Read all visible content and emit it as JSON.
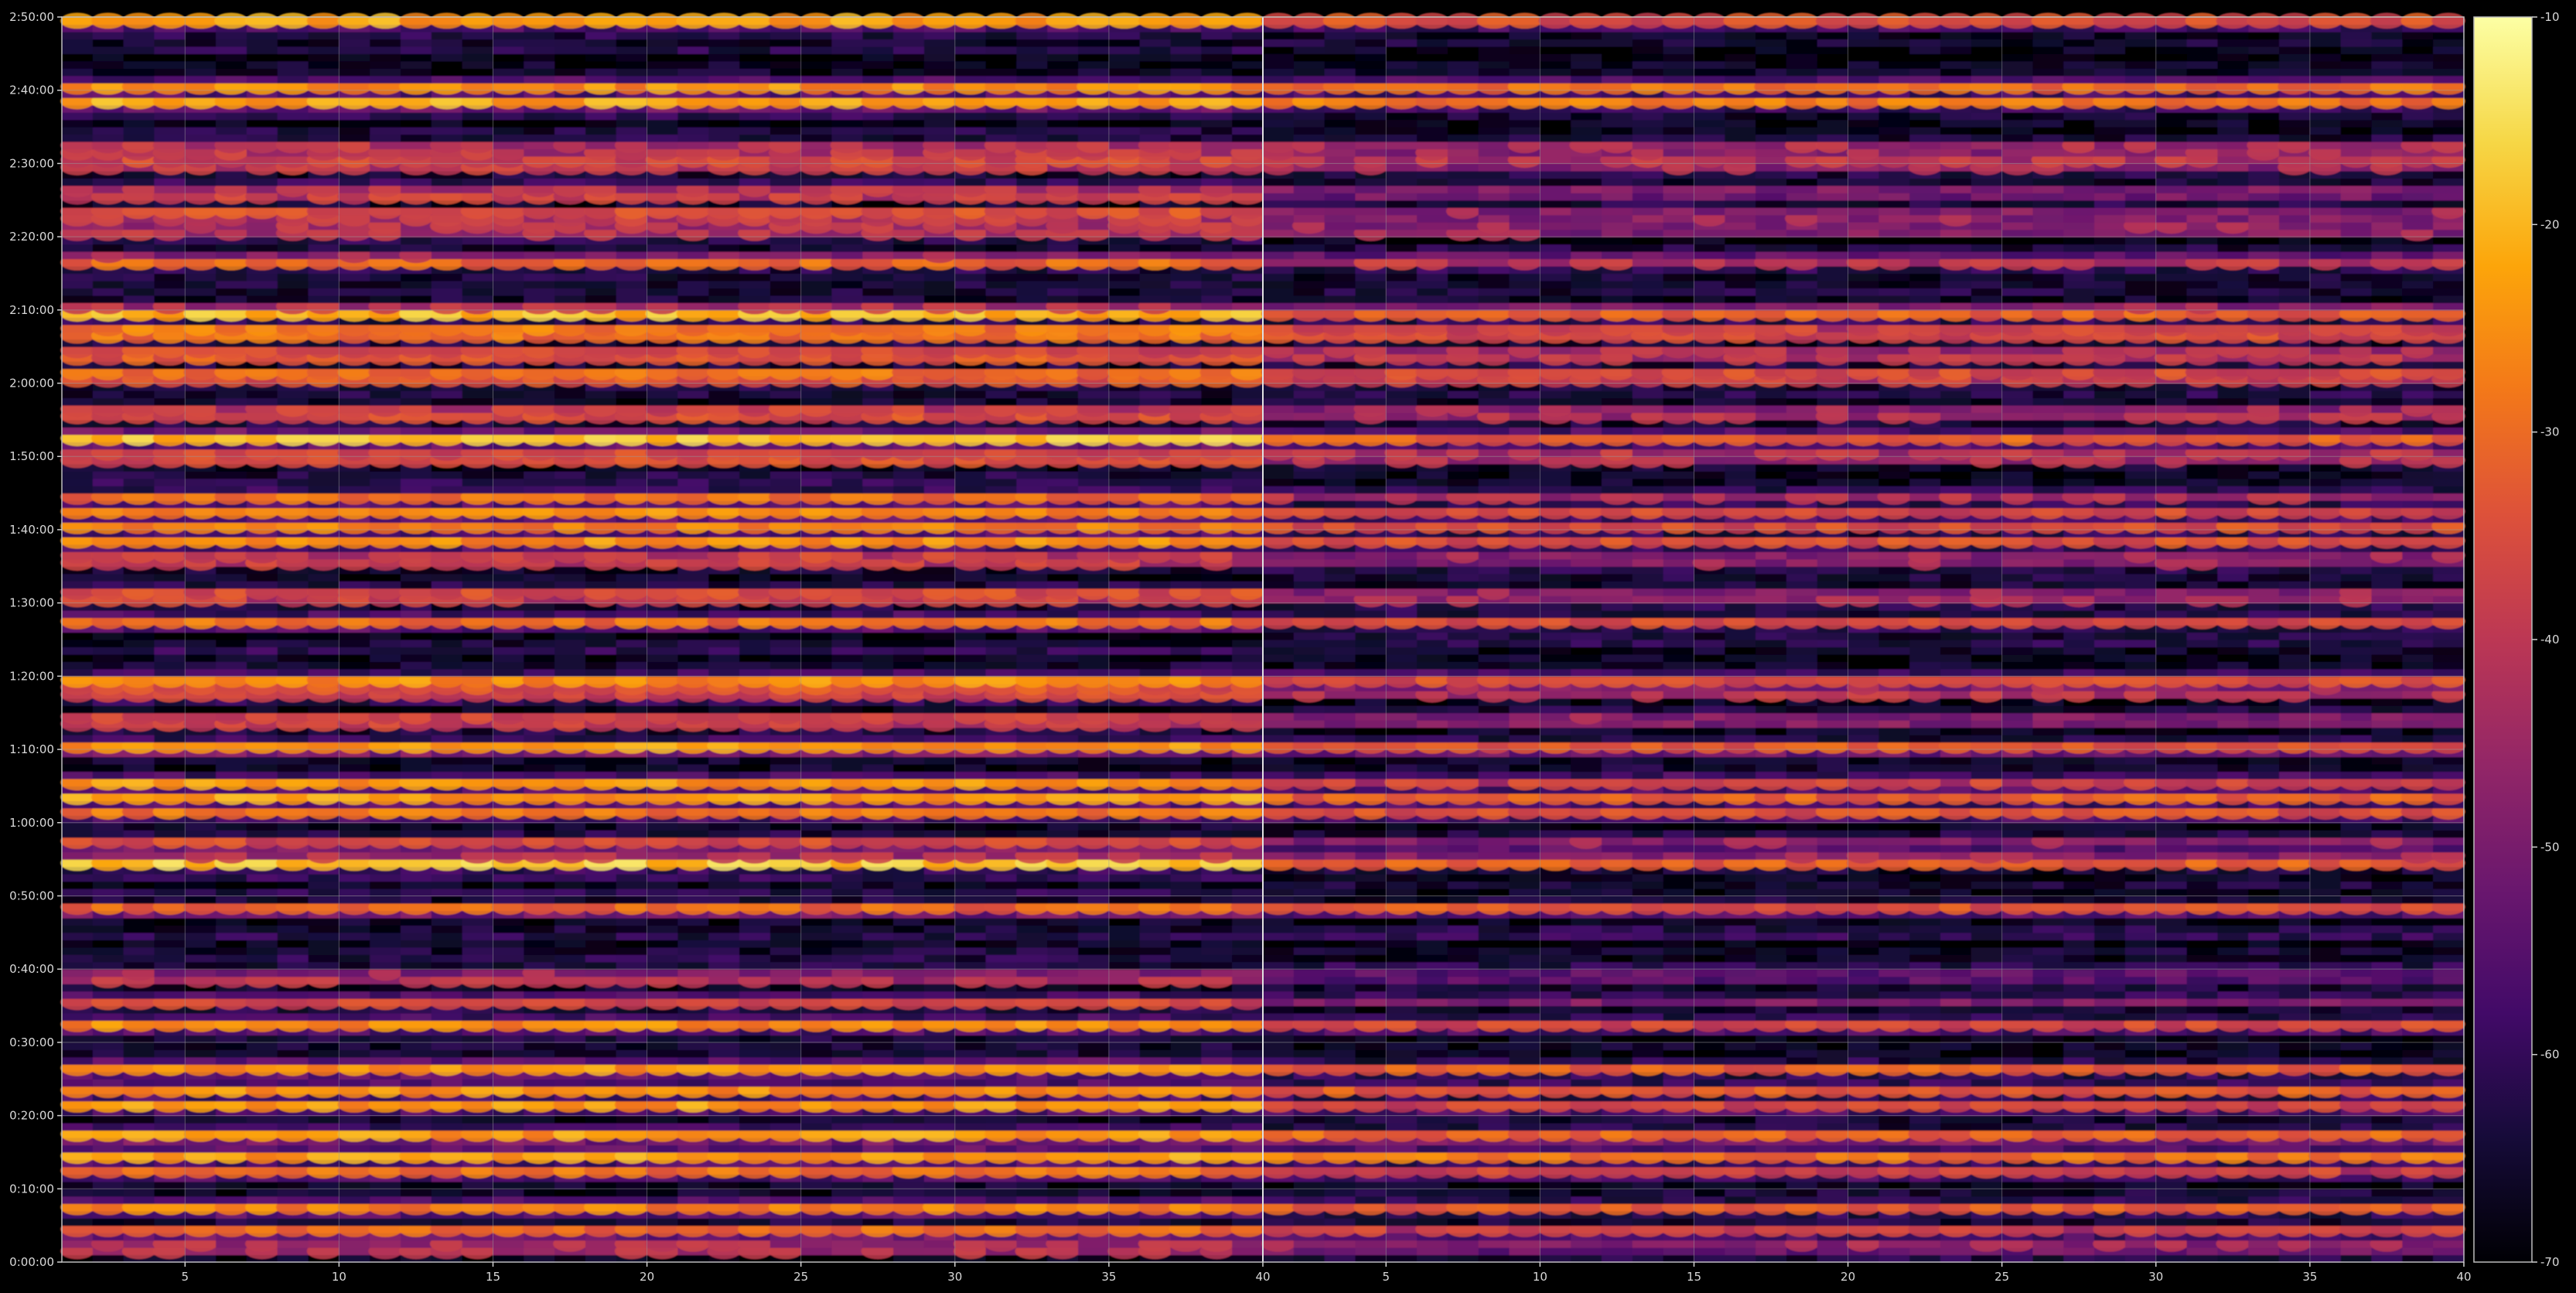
{
  "chart_data": {
    "type": "heatmap",
    "title": "",
    "panels": [
      {
        "name": "left",
        "x_ticks": [
          5,
          10,
          15,
          20,
          25,
          30,
          35,
          40
        ],
        "xlim": [
          1,
          40
        ]
      },
      {
        "name": "right",
        "x_ticks": [
          5,
          10,
          15,
          20,
          25,
          30,
          35,
          40
        ],
        "xlim": [
          1,
          40
        ]
      }
    ],
    "y_ticks": [
      "0:00:00",
      "0:10:00",
      "0:20:00",
      "0:30:00",
      "0:40:00",
      "0:50:00",
      "1:00:00",
      "1:10:00",
      "1:20:00",
      "1:30:00",
      "1:40:00",
      "1:50:00",
      "2:00:00",
      "2:10:00",
      "2:20:00",
      "2:30:00",
      "2:40:00",
      "2:50:00"
    ],
    "ylim_seconds": [
      0,
      10200
    ],
    "colorbar": {
      "colormap": "inferno",
      "range": [
        -70,
        -10
      ],
      "ticks": [
        "-10",
        "-20",
        "-30",
        "-40",
        "-50",
        "-60",
        "-70"
      ]
    },
    "hot_bands_minutes": [
      {
        "t": 2,
        "v": -35
      },
      {
        "t": 4.3,
        "v": -34
      },
      {
        "t": 7.5,
        "v": -30
      },
      {
        "t": 12.5,
        "v": -32
      },
      {
        "t": 14.5,
        "v": -24
      },
      {
        "t": 17.3,
        "v": -26
      },
      {
        "t": 21.5,
        "v": -30
      },
      {
        "t": 23.5,
        "v": -28
      },
      {
        "t": 26.5,
        "v": -29
      },
      {
        "t": 32.5,
        "v": -30
      },
      {
        "t": 35.5,
        "v": -40
      },
      {
        "t": 39,
        "v": -40
      },
      {
        "t": 48.3,
        "v": -30
      },
      {
        "t": 54.7,
        "v": -22
      },
      {
        "t": 57.2,
        "v": -35
      },
      {
        "t": 61.5,
        "v": -30
      },
      {
        "t": 63.5,
        "v": -28
      },
      {
        "t": 65.5,
        "v": -30
      },
      {
        "t": 70.3,
        "v": -28
      },
      {
        "t": 74,
        "v": -32
      },
      {
        "t": 78,
        "v": -30
      },
      {
        "t": 79.5,
        "v": -28
      },
      {
        "t": 87.5,
        "v": -32
      },
      {
        "t": 91,
        "v": -30
      },
      {
        "t": 96,
        "v": -32
      },
      {
        "t": 98.5,
        "v": -30
      },
      {
        "t": 100.5,
        "v": -32
      },
      {
        "t": 102.5,
        "v": -28
      },
      {
        "t": 104.5,
        "v": -34
      },
      {
        "t": 110,
        "v": -30
      },
      {
        "t": 112.5,
        "v": -24
      },
      {
        "t": 116,
        "v": -30
      },
      {
        "t": 121,
        "v": -24
      },
      {
        "t": 124,
        "v": -28
      },
      {
        "t": 127,
        "v": -22
      },
      {
        "t": 129.7,
        "v": -22
      },
      {
        "t": 136.8,
        "v": -30
      },
      {
        "t": 141,
        "v": -34
      },
      {
        "t": 143,
        "v": -32
      },
      {
        "t": 146,
        "v": -35
      },
      {
        "t": 150,
        "v": -30
      },
      {
        "t": 152,
        "v": -32
      },
      {
        "t": 158.5,
        "v": -24
      },
      {
        "t": 160.5,
        "v": -26
      },
      {
        "t": 169.5,
        "v": -28
      }
    ]
  }
}
